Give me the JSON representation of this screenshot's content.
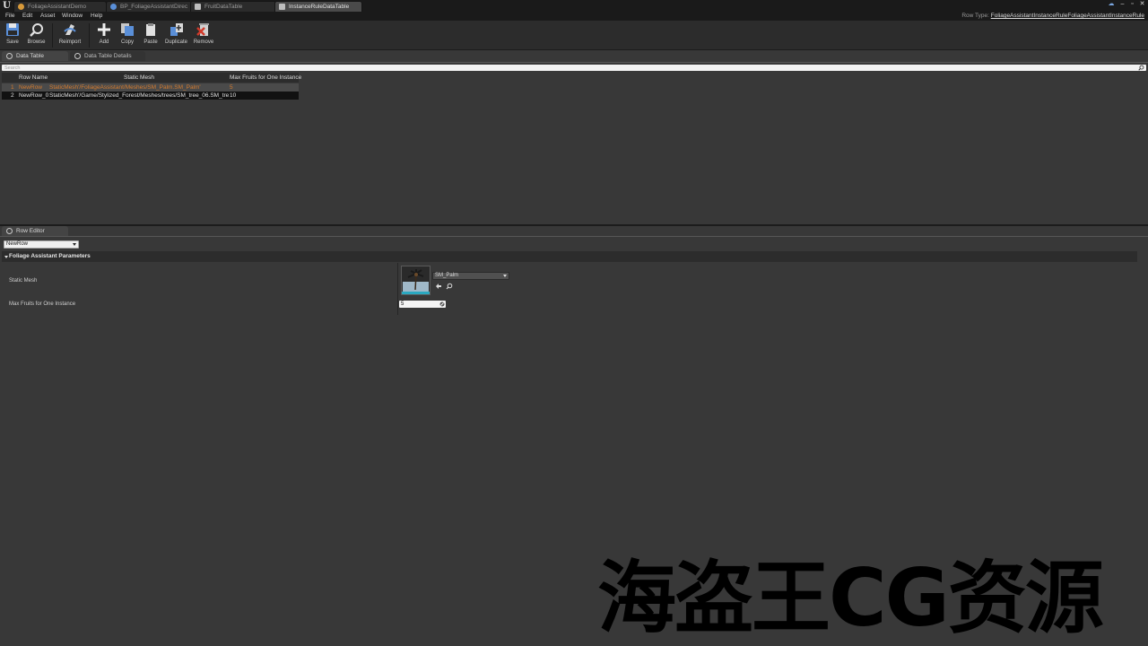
{
  "window": {
    "tabs": [
      {
        "label": "FoliageAssistantDemo",
        "active": false
      },
      {
        "label": "BP_FoliageAssistantDirec",
        "active": false
      },
      {
        "label": "FruitDataTable",
        "active": false
      },
      {
        "label": "InstanceRuleDataTable",
        "active": true
      }
    ],
    "controls": [
      "minimize",
      "restore",
      "close"
    ]
  },
  "menu": {
    "items": [
      "File",
      "Edit",
      "Asset",
      "Window",
      "Help"
    ],
    "row_type_label": "Row Type:",
    "row_type_value": "FoliageAssistantInstanceRuleFoliageAssistantInstanceRule"
  },
  "toolbar": {
    "buttons": [
      {
        "label": "Save",
        "icon": "save-icon"
      },
      {
        "label": "Browse",
        "icon": "browse-icon"
      },
      {
        "label": "Reimport",
        "icon": "reimport-icon"
      },
      {
        "label": "Add",
        "icon": "add-icon"
      },
      {
        "label": "Copy",
        "icon": "copy-icon"
      },
      {
        "label": "Paste",
        "icon": "paste-icon"
      },
      {
        "label": "Duplicate",
        "icon": "duplicate-icon"
      },
      {
        "label": "Remove",
        "icon": "remove-icon"
      }
    ]
  },
  "panels": {
    "data_table_tab": "Data Table",
    "details_tab": "Data Table Details",
    "row_editor_tab": "Row Editor"
  },
  "search": {
    "placeholder": "Search"
  },
  "table": {
    "columns": [
      "Row Name",
      "Static Mesh",
      "Max Fruits for One Instance"
    ],
    "rows": [
      {
        "index": "1",
        "name": "NewRow",
        "mesh": "StaticMesh'/FoliageAssistant/Meshes/SM_Palm.SM_Palm'",
        "max": "5",
        "selected": true
      },
      {
        "index": "2",
        "name": "NewRow_0",
        "mesh": "StaticMesh'/Game/Stylized_Forest/Meshes/trees/SM_tree_06.SM_tree_06'",
        "max": "10",
        "selected": false
      }
    ]
  },
  "row_editor": {
    "selected_row": "NewRow",
    "category": "Foliage Assistant Parameters",
    "static_mesh_label": "Static Mesh",
    "static_mesh_value": "SM_Palm",
    "max_fruits_label": "Max Fruits for One Instance",
    "max_fruits_value": "5"
  },
  "watermark": {
    "text": "海盗王CG资源"
  },
  "colors": {
    "selected_row_text": "#d47b2f",
    "background": "#383838",
    "chrome": "#1a1a1a"
  }
}
